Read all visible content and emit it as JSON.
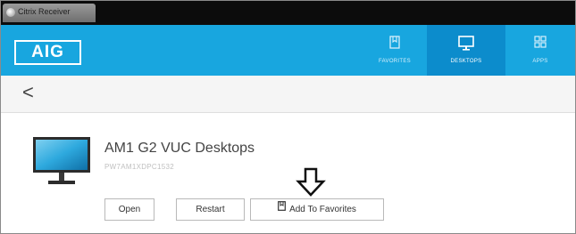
{
  "window": {
    "title": "Citrix Receiver"
  },
  "header": {
    "logo": "AIG",
    "tabs": [
      {
        "label": "FAVORITES",
        "icon": "bookmark-icon",
        "active": false
      },
      {
        "label": "DESKTOPS",
        "icon": "monitor-icon",
        "active": true
      },
      {
        "label": "APPS",
        "icon": "grid-icon",
        "active": false
      }
    ]
  },
  "nav": {
    "back_label": "<"
  },
  "resource": {
    "name": "AM1 G2 VUC Desktops",
    "id": "PW7AM1XDPC1532",
    "buttons": {
      "open": "Open",
      "restart": "Restart",
      "add_to_favorites": "Add To Favorites"
    }
  },
  "colors": {
    "header_bg": "#18a6df",
    "active_tab_bg": "#0c8ccc",
    "titlebar_bg": "#0c0c0c"
  }
}
